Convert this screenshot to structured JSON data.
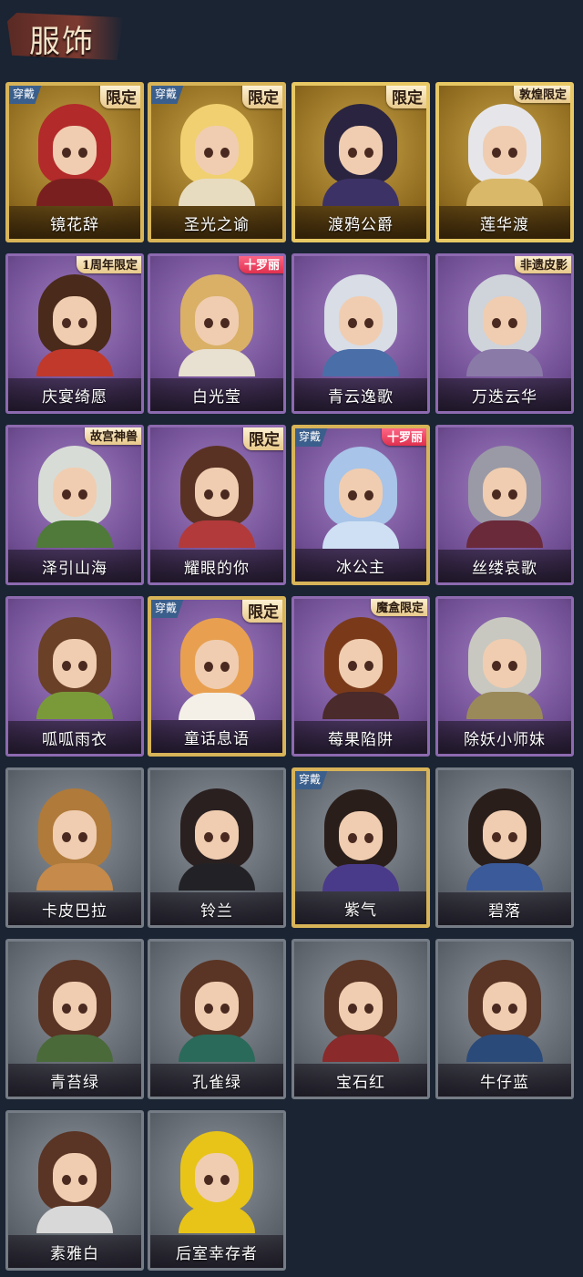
{
  "header": {
    "title": "服饰"
  },
  "colors": {
    "background": "#1a2433",
    "gold": "#e7c864",
    "purple": "#8d6ab0",
    "gray": "#767c85",
    "wear_badge": "#3b5f8c"
  },
  "costumes": [
    {
      "name": "镜花辞",
      "tier": "gold",
      "badge": "穿戴",
      "tag": "限定",
      "hair": "#b22a2a",
      "outfit": "#7a1f1f"
    },
    {
      "name": "圣光之谕",
      "tier": "gold",
      "badge": "穿戴",
      "tag": "限定",
      "hair": "#f0d070",
      "outfit": "#e8dcc0"
    },
    {
      "name": "渡鸦公爵",
      "tier": "gold",
      "badge": "",
      "tag": "限定",
      "hair": "#2a2440",
      "outfit": "#3d3266"
    },
    {
      "name": "莲华渡",
      "tier": "gold",
      "badge": "",
      "tag": "敦煌限定",
      "hair": "#e6e6ea",
      "outfit": "#d9b86a"
    },
    {
      "name": "庆宴绮愿",
      "tier": "purple",
      "badge": "",
      "tag": "1周年限定",
      "hair": "#4a2a1a",
      "outfit": "#c0392b"
    },
    {
      "name": "白光莹",
      "tier": "purple",
      "badge": "",
      "tag": "十罗丽",
      "hair": "#d9b066",
      "outfit": "#e8e0d0"
    },
    {
      "name": "青云逸歌",
      "tier": "purple",
      "badge": "",
      "tag": "",
      "hair": "#d8dde6",
      "outfit": "#4a6ea8"
    },
    {
      "name": "万迭云华",
      "tier": "purple",
      "badge": "",
      "tag": "非遗皮影",
      "hair": "#cfd3da",
      "outfit": "#8a7aa8"
    },
    {
      "name": "泽引山海",
      "tier": "purple",
      "badge": "",
      "tag": "故宫神兽",
      "hair": "#d8dcd6",
      "outfit": "#4f7a3a"
    },
    {
      "name": "耀眼的你",
      "tier": "purple",
      "badge": "",
      "tag": "限定",
      "hair": "#5a3224",
      "outfit": "#b23a3a"
    },
    {
      "name": "冰公主",
      "tier": "purple",
      "badge": "穿戴",
      "tag": "十罗丽",
      "hair": "#a8c4e8",
      "outfit": "#cfe0f4"
    },
    {
      "name": "丝缕哀歌",
      "tier": "purple",
      "badge": "",
      "tag": "",
      "hair": "#9a9aa6",
      "outfit": "#6a2a3a"
    },
    {
      "name": "呱呱雨衣",
      "tier": "purple",
      "badge": "",
      "tag": "",
      "hair": "#6a4026",
      "outfit": "#7a9a3a"
    },
    {
      "name": "童话息语",
      "tier": "purple",
      "badge": "穿戴",
      "tag": "限定",
      "hair": "#e8a050",
      "outfit": "#f4f0e8"
    },
    {
      "name": "莓果陷阱",
      "tier": "purple",
      "badge": "",
      "tag": "魔盒限定",
      "hair": "#7a3a1a",
      "outfit": "#4a2a2a"
    },
    {
      "name": "除妖小师妹",
      "tier": "purple",
      "badge": "",
      "tag": "",
      "hair": "#c8c8c0",
      "outfit": "#9a8a5a"
    },
    {
      "name": "卡皮巴拉",
      "tier": "gray",
      "badge": "",
      "tag": "",
      "hair": "#b07a3a",
      "outfit": "#c68a4a"
    },
    {
      "name": "铃兰",
      "tier": "gray",
      "badge": "",
      "tag": "",
      "hair": "#2a2020",
      "outfit": "#222226"
    },
    {
      "name": "紫气",
      "tier": "gray",
      "badge": "穿戴",
      "tag": "",
      "hair": "#2a1e1a",
      "outfit": "#4a3a8a"
    },
    {
      "name": "碧落",
      "tier": "gray",
      "badge": "",
      "tag": "",
      "hair": "#2a1e1a",
      "outfit": "#3a5a9a"
    },
    {
      "name": "青苔绿",
      "tier": "gray",
      "badge": "",
      "tag": "",
      "hair": "#5a3424",
      "outfit": "#4a6a3a"
    },
    {
      "name": "孔雀绿",
      "tier": "gray",
      "badge": "",
      "tag": "",
      "hair": "#5a3424",
      "outfit": "#2a6a5a"
    },
    {
      "name": "宝石红",
      "tier": "gray",
      "badge": "",
      "tag": "",
      "hair": "#5a3424",
      "outfit": "#8a2a2a"
    },
    {
      "name": "牛仔蓝",
      "tier": "gray",
      "badge": "",
      "tag": "",
      "hair": "#5a3424",
      "outfit": "#2a4a7a"
    },
    {
      "name": "素雅白",
      "tier": "gray",
      "badge": "",
      "tag": "",
      "hair": "#5a3424",
      "outfit": "#d8d8d8"
    },
    {
      "name": "后室幸存者",
      "tier": "gray",
      "badge": "",
      "tag": "",
      "hair": "#e8c418",
      "outfit": "#e8c418"
    }
  ]
}
